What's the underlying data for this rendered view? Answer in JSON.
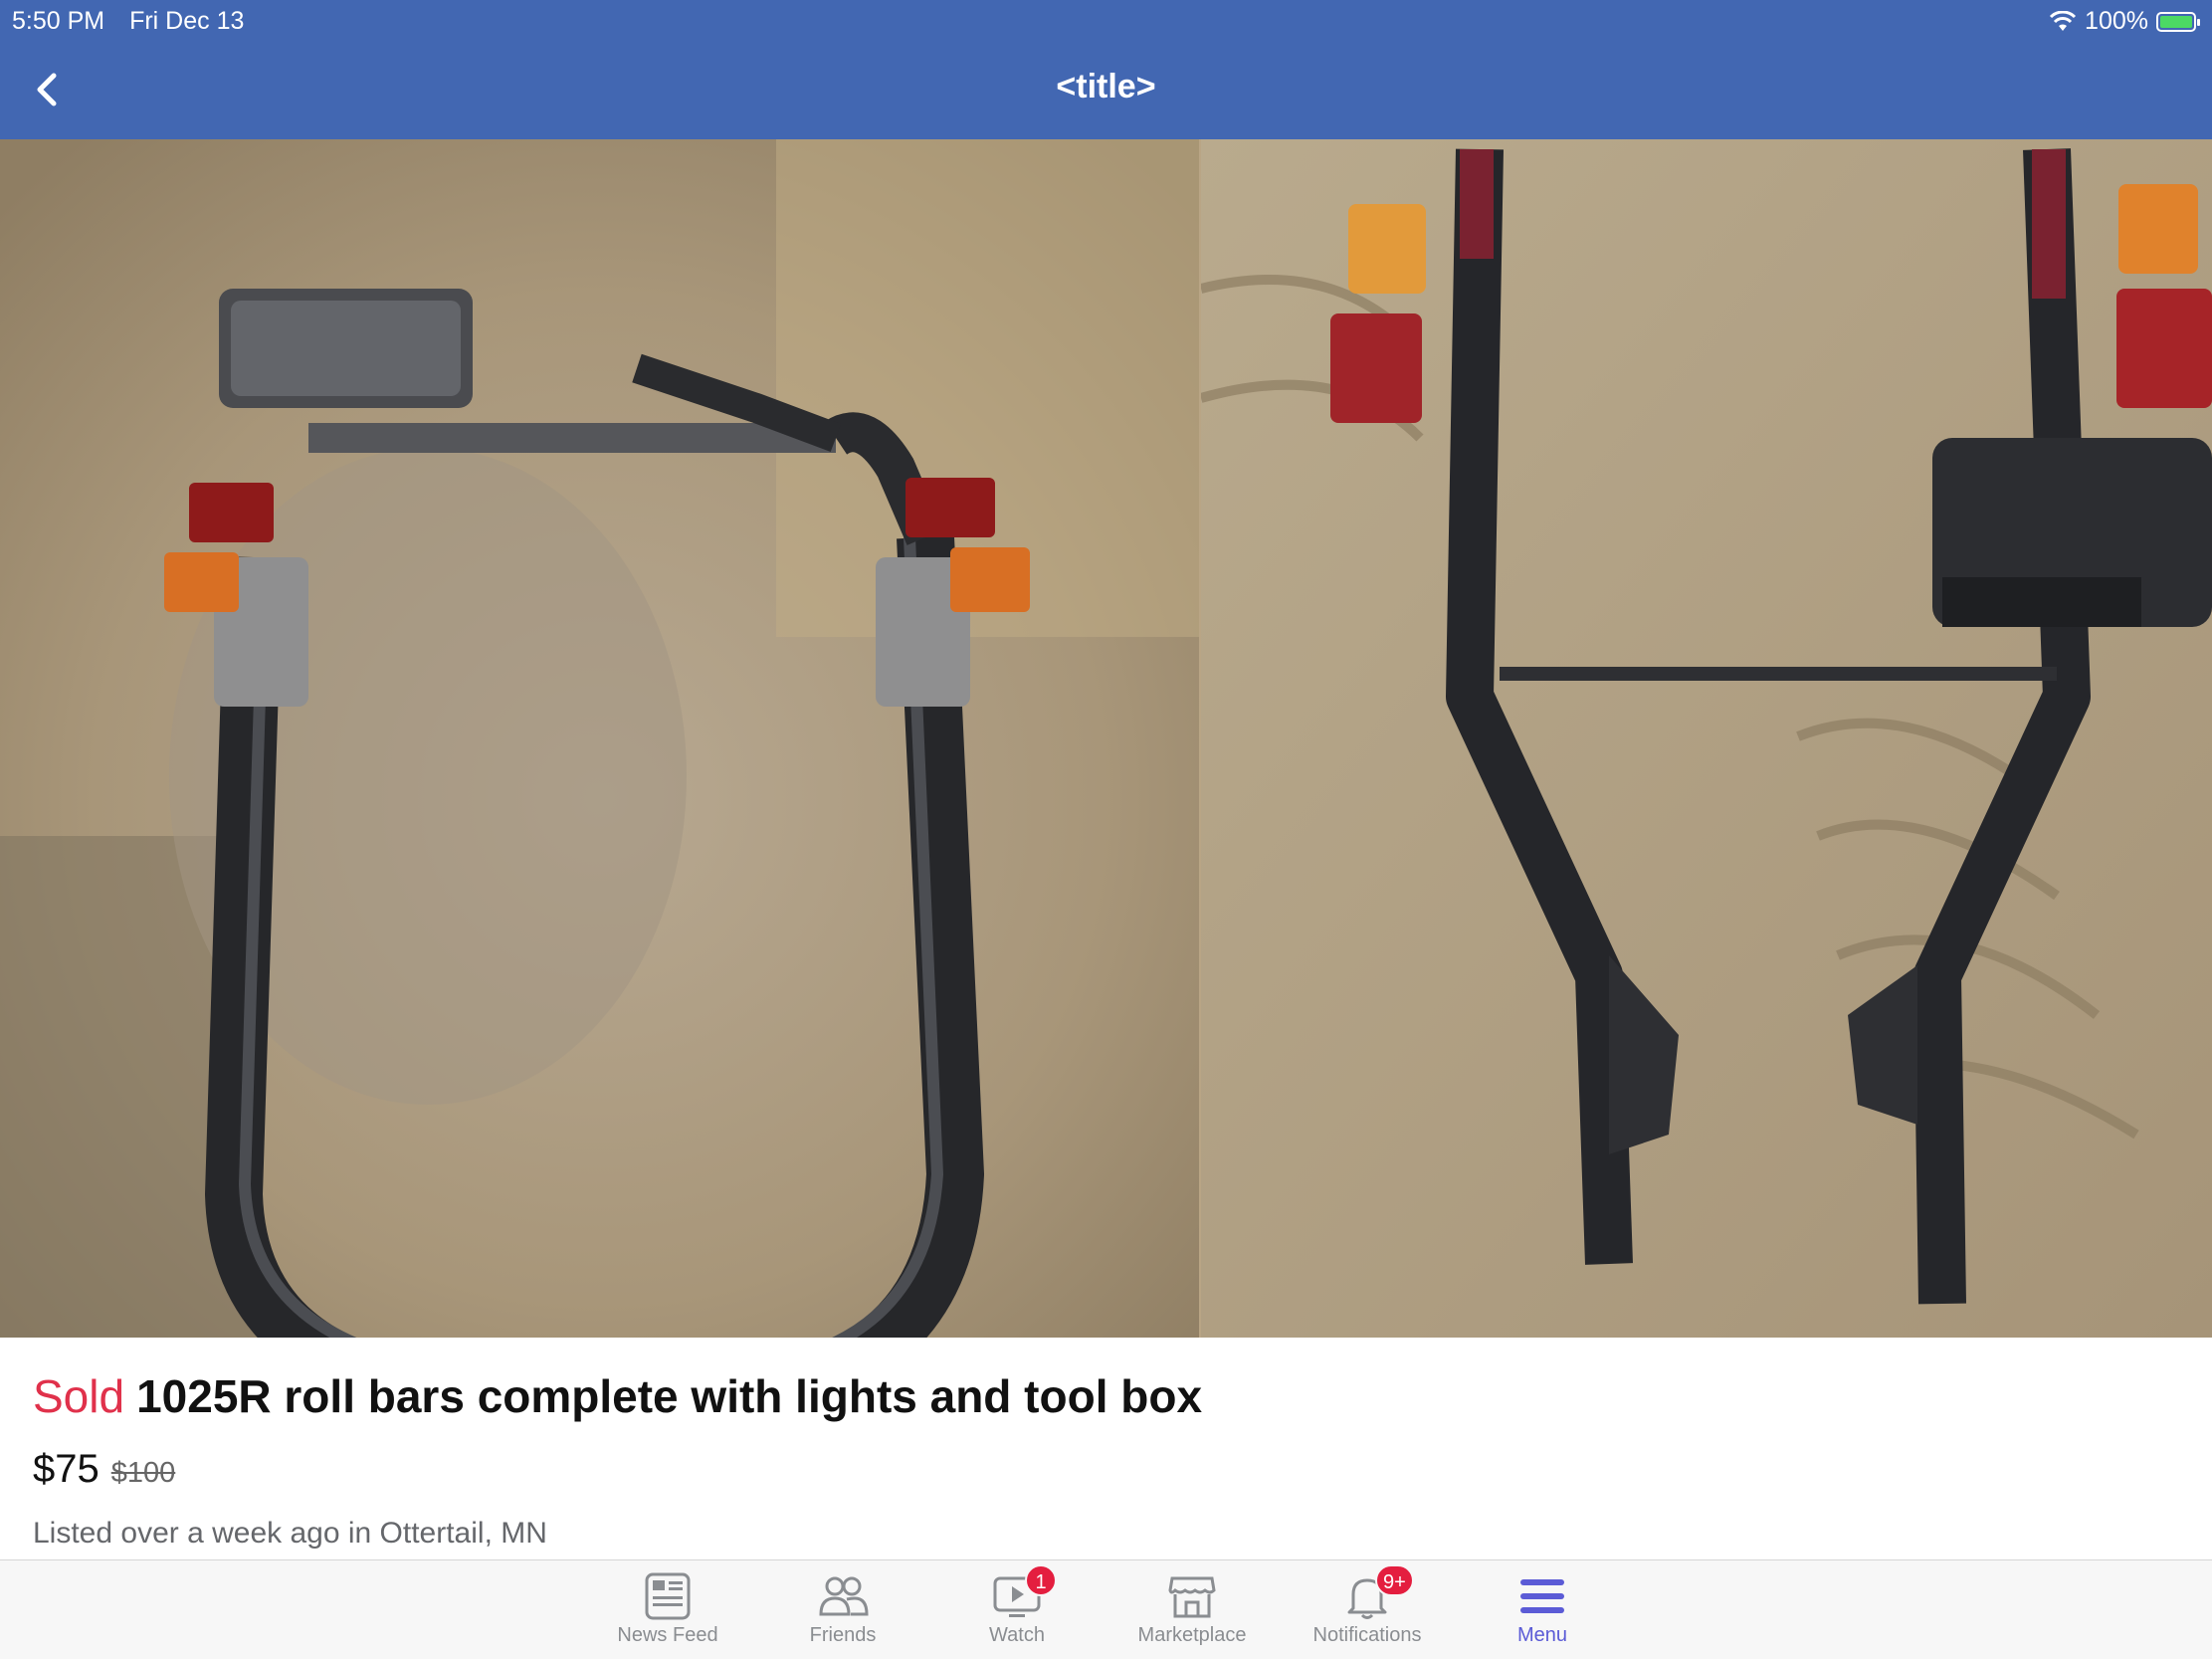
{
  "status_bar": {
    "time": "5:50 PM",
    "date": "Fri Dec 13",
    "battery": "100%"
  },
  "nav": {
    "title": "<title>"
  },
  "listing": {
    "status": "Sold",
    "title": "1025R roll bars complete with lights and tool box",
    "price": "$75",
    "original_price": "$100",
    "meta": "Listed over a week ago in Ottertail, MN"
  },
  "tabbar": {
    "tabs": [
      {
        "label": "News Feed",
        "icon": "news-feed-icon"
      },
      {
        "label": "Friends",
        "icon": "friends-icon"
      },
      {
        "label": "Watch",
        "icon": "watch-icon",
        "badge": "1"
      },
      {
        "label": "Marketplace",
        "icon": "marketplace-icon"
      },
      {
        "label": "Notifications",
        "icon": "bell-icon",
        "badge": "9+"
      },
      {
        "label": "Menu",
        "icon": "menu-icon",
        "active": true
      }
    ]
  },
  "colors": {
    "header": "#4267b2",
    "sold": "#e0314b",
    "active_tab": "#5b5bd6",
    "badge": "#e41e3f"
  }
}
